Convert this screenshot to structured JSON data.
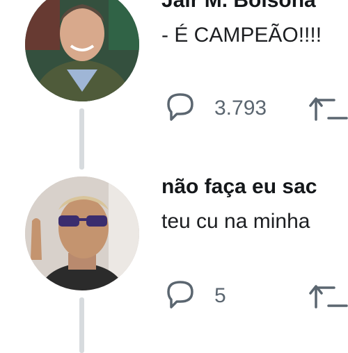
{
  "tweets": [
    {
      "author": "Jair M. Bolsona",
      "text": "- É CAMPEÃO!!!!",
      "reply_count": "3.793",
      "avatar": "avatar-photo-man-in-jacket"
    },
    {
      "author": "não faça eu sac",
      "text": "teu cu na minha",
      "reply_count": "5",
      "avatar": "avatar-photo-man-with-sunglasses"
    }
  ],
  "icons": {
    "reply": "reply-icon",
    "retweet": "retweet-icon"
  },
  "colors": {
    "icon": "#5b6670",
    "thread_line": "#d7dbde"
  }
}
